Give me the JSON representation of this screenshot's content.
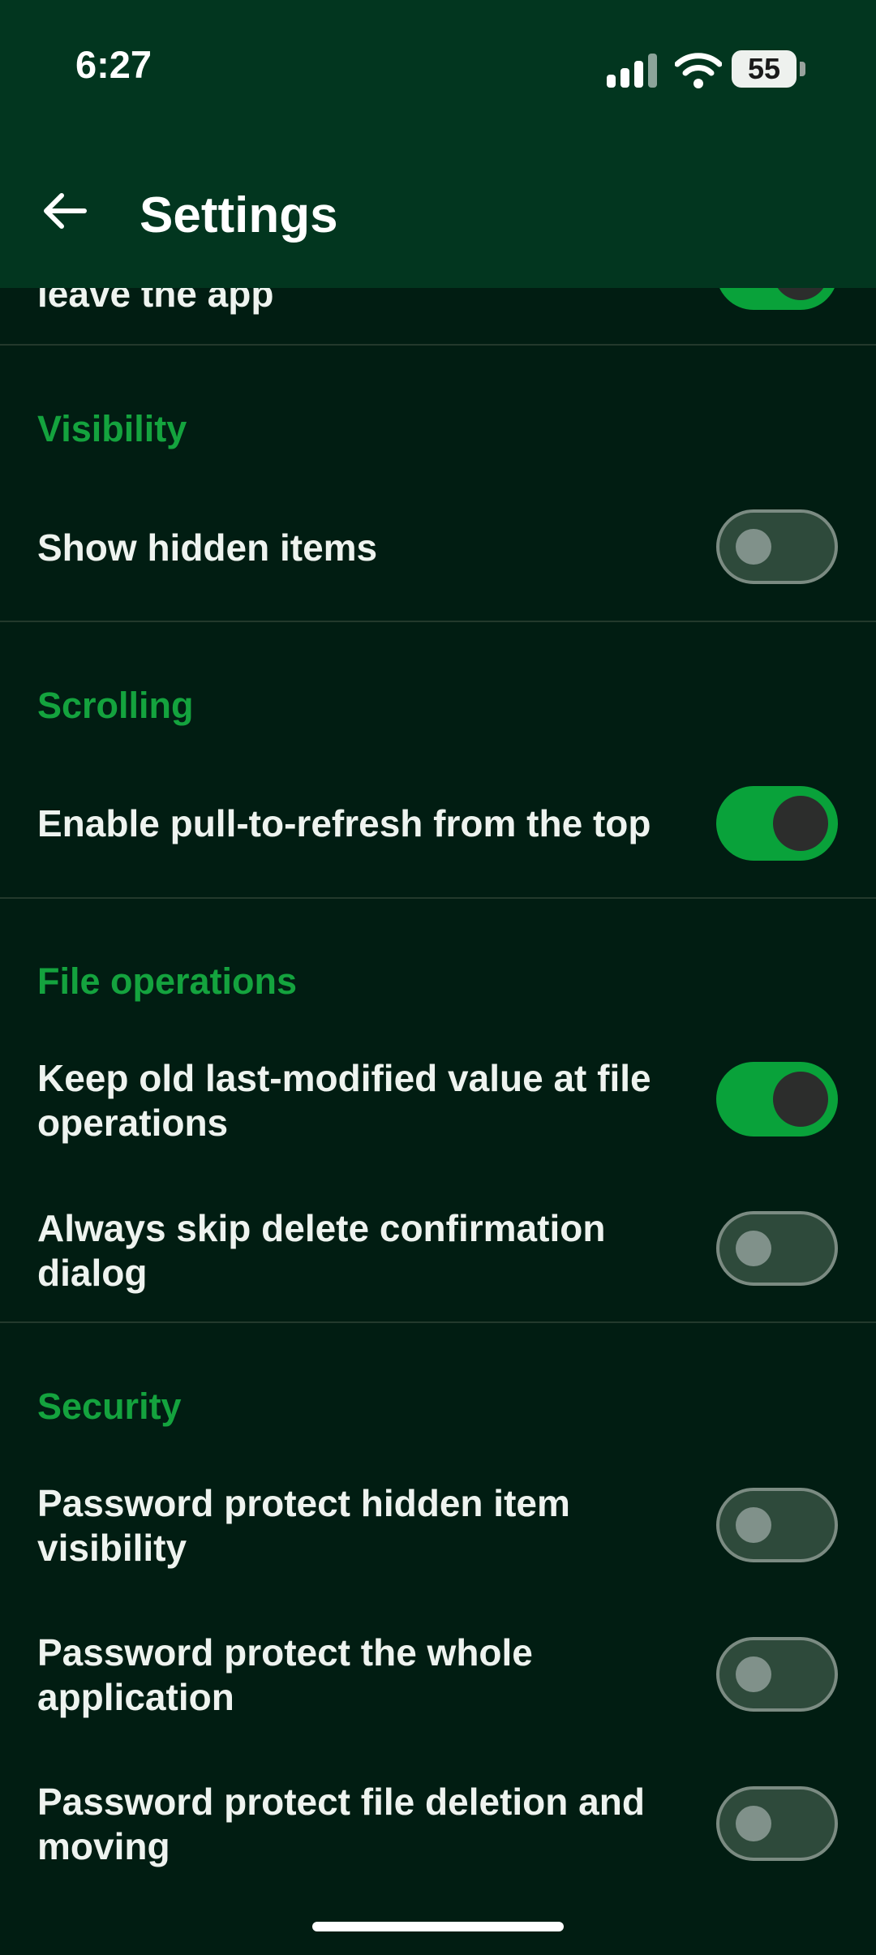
{
  "status_bar": {
    "time": "6:27",
    "battery": "55"
  },
  "header": {
    "title": "Settings"
  },
  "partial_item": {
    "label": "leave the app",
    "enabled": true
  },
  "sections": {
    "visibility": {
      "title": "Visibility",
      "items": [
        {
          "label": "Show hidden items",
          "enabled": false
        }
      ]
    },
    "scrolling": {
      "title": "Scrolling",
      "items": [
        {
          "label": "Enable pull-to-refresh from the top",
          "enabled": true
        }
      ]
    },
    "file_operations": {
      "title": "File operations",
      "items": [
        {
          "label": "Keep old last-modified value at file operations",
          "line1": "Keep old last-modified value at file",
          "line2": "operations",
          "enabled": true
        },
        {
          "label": "Always skip delete confirmation dialog",
          "line1": "Always skip delete confirmation",
          "line2": "dialog",
          "enabled": false
        }
      ]
    },
    "security": {
      "title": "Security",
      "items": [
        {
          "label": "Password protect hidden item visibility",
          "line1": "Password protect hidden item",
          "line2": "visibility",
          "enabled": false
        },
        {
          "label": "Password protect the whole application",
          "line1": "Password protect the whole",
          "line2": "application",
          "enabled": false
        },
        {
          "label": "Password protect file deletion and moving",
          "line1": "Password protect file deletion and",
          "line2": "moving",
          "enabled": false
        }
      ]
    }
  },
  "colors": {
    "header_bg": "#02361f",
    "page_bg": "#011d12",
    "accent": "#14a33e",
    "toggle_on": "#09a23a"
  }
}
